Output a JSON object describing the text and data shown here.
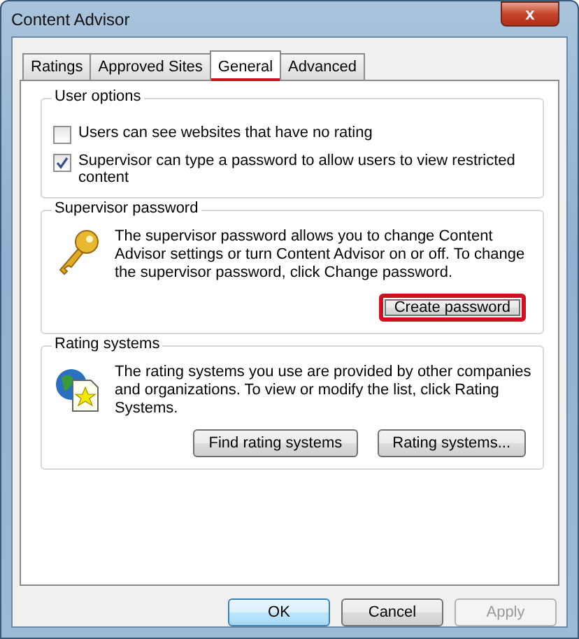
{
  "window": {
    "title": "Content Advisor",
    "close_label": "x"
  },
  "tabs": [
    {
      "label": "Ratings",
      "selected": false,
      "highlighted": false
    },
    {
      "label": "Approved Sites",
      "selected": false,
      "highlighted": false
    },
    {
      "label": "General",
      "selected": true,
      "highlighted": true
    },
    {
      "label": "Advanced",
      "selected": false,
      "highlighted": false
    }
  ],
  "groups": [
    {
      "kind": "options",
      "title": "User options",
      "options": [
        {
          "label": "Users can see websites that have no rating",
          "checked": false
        },
        {
          "label": "Supervisor can type a password to allow users to view restricted content",
          "checked": true
        }
      ]
    },
    {
      "kind": "info",
      "title": "Supervisor password",
      "text": "The supervisor password allows you to change Content Advisor settings or turn Content Advisor on or off. To change the supervisor password, click Change password.",
      "buttons": [
        {
          "label": "Create password",
          "highlighted": true
        }
      ]
    },
    {
      "kind": "info",
      "title": "Rating systems",
      "text": "The rating systems you use are provided by other companies and organizations. To view or modify the list, click Rating Systems.",
      "buttons": [
        {
          "label": "Find rating systems",
          "highlighted": false
        },
        {
          "label": "Rating systems...",
          "highlighted": false
        }
      ]
    }
  ],
  "buttons": [
    {
      "label": "OK",
      "default": true,
      "disabled": false
    },
    {
      "label": "Cancel",
      "default": false,
      "disabled": false
    },
    {
      "label": "Apply",
      "default": false,
      "disabled": true
    }
  ]
}
